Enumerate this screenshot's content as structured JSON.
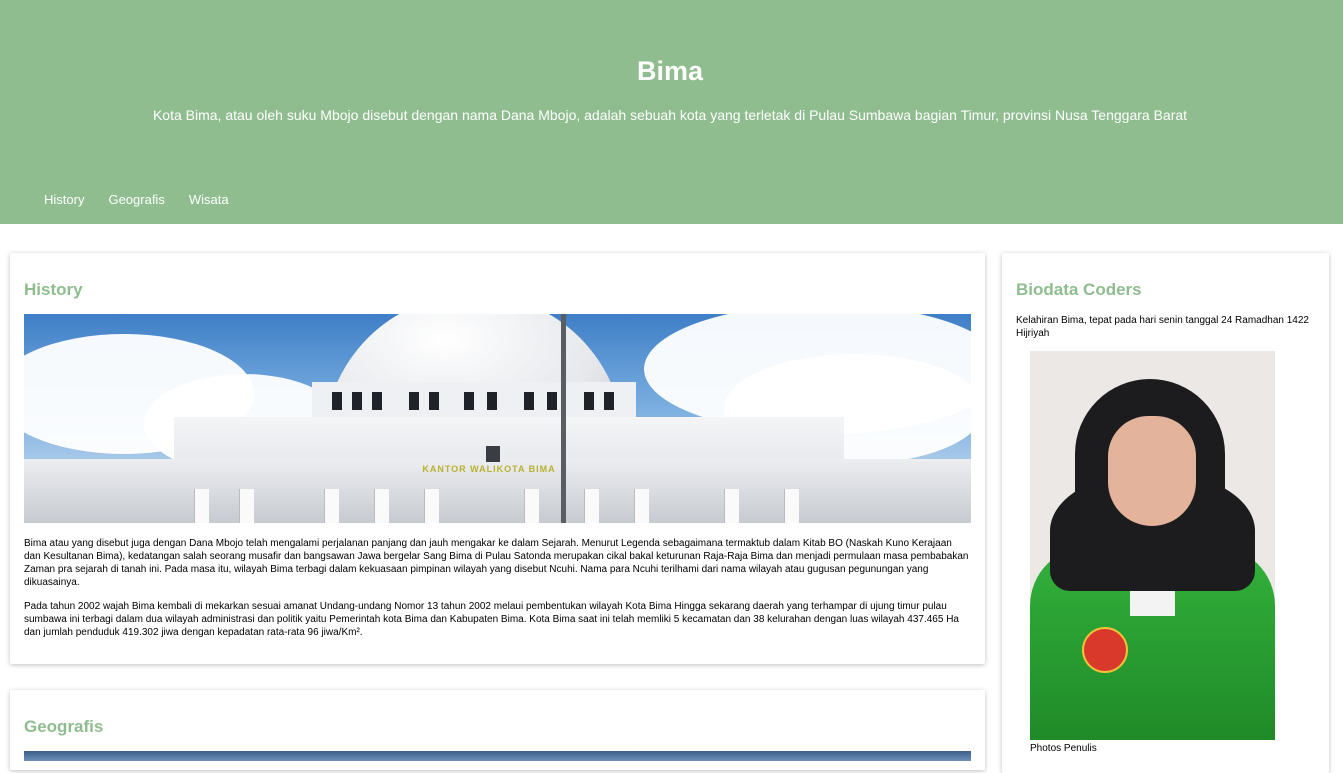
{
  "header": {
    "title": "Bima",
    "subtitle": "Kota Bima, atau oleh suku Mbojo disebut dengan nama Dana Mbojo, adalah sebuah kota yang terletak di Pulau Sumbawa bagian Timur, provinsi Nusa Tenggara Barat",
    "background_color": "#8fbd8f"
  },
  "nav": {
    "items": [
      {
        "label": "History"
      },
      {
        "label": "Geografis"
      },
      {
        "label": "Wisata"
      }
    ]
  },
  "main": {
    "history": {
      "heading": "History",
      "image_sign": "KANTOR WALIKOTA BIMA",
      "paragraph1": "Bima atau yang disebut juga dengan Dana Mbojo telah mengalami perjalanan panjang dan jauh mengakar ke dalam Sejarah. Menurut Legenda sebagaimana termaktub dalam Kitab BO (Naskah Kuno Kerajaan dan Kesultanan Bima), kedatangan salah seorang musafir dan bangsawan Jawa bergelar Sang Bima di Pulau Satonda merupakan cikal bakal keturunan Raja-Raja Bima dan menjadi permulaan masa pembabakan Zaman pra sejarah di tanah ini. Pada masa itu, wilayah Bima terbagi dalam kekuasaan pimpinan wilayah yang disebut Ncuhi. Nama para Ncuhi terilhami dari nama wilayah atau gugusan pegunungan yang dikuasainya.",
      "paragraph2": "Pada tahun 2002 wajah Bima kembali di mekarkan sesuai amanat Undang-undang Nomor 13 tahun 2002 melaui pembentukan wilayah Kota Bima  Hingga sekarang daerah yang terhampar di ujung timur pulau sumbawa ini terbagi dalam dua wilayah administrasi dan politik yaitu Pemerintah kota Bima dan Kabupaten Bima. Kota Bima saat ini telah memliki 5 kecamatan dan 38 kelurahan dengan luas wilayah 437.465 Ha dan jumlah penduduk 419.302 jiwa dengan kepadatan rata-rata 96 jiwa/Km²."
    },
    "geografis": {
      "heading": "Geografis"
    }
  },
  "sidebar": {
    "heading": "Biodata Coders",
    "text": "Kelahiran Bima, tepat pada hari senin tanggal 24 Ramadhan 1422 Hijriyah",
    "photo_caption": "Photos Penulis"
  },
  "colors": {
    "accent": "#8fbd8f"
  }
}
